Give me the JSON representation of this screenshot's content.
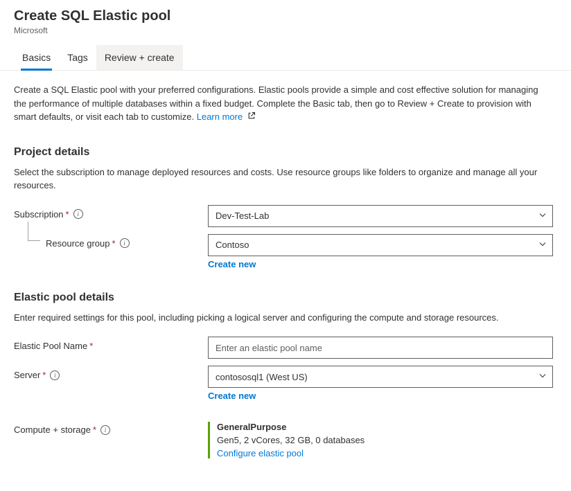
{
  "header": {
    "title": "Create SQL Elastic pool",
    "subtitle": "Microsoft"
  },
  "tabs": {
    "basics": "Basics",
    "tags": "Tags",
    "review": "Review + create"
  },
  "intro": {
    "text": "Create a SQL Elastic pool with your preferred configurations. Elastic pools provide a simple and cost effective solution for managing the performance of multiple databases within a fixed budget. Complete the Basic tab, then go to Review + Create to provision with smart defaults, or visit each tab to customize.",
    "learn_more": "Learn more"
  },
  "project_details": {
    "title": "Project details",
    "desc": "Select the subscription to manage deployed resources and costs. Use resource groups like folders to organize and manage all your resources.",
    "subscription_label": "Subscription",
    "subscription_value": "Dev-Test-Lab",
    "resource_group_label": "Resource group",
    "resource_group_value": "Contoso",
    "create_new": "Create new"
  },
  "elastic_pool": {
    "title": "Elastic pool details",
    "desc": "Enter required settings for this pool, including picking a logical server and configuring the compute and storage resources.",
    "name_label": "Elastic Pool Name",
    "name_placeholder": "Enter an elastic pool name",
    "server_label": "Server",
    "server_value": "contososql1 (West US)",
    "create_new": "Create new",
    "compute_label": "Compute + storage",
    "compute_title": "GeneralPurpose",
    "compute_detail": "Gen5, 2 vCores, 32 GB, 0 databases",
    "configure_link": "Configure elastic pool"
  }
}
